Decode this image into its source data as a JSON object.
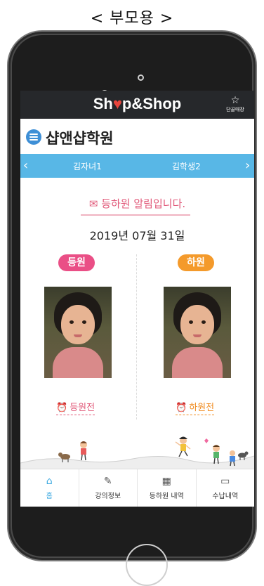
{
  "caption": "< 부모용 >",
  "header": {
    "logo_pre": "Sh",
    "logo_pin": "♥",
    "logo_post": "p&Shop",
    "store_icon": "star-icon",
    "store_label": "단골매장"
  },
  "academy": {
    "name": "샵앤샵학원"
  },
  "children": {
    "items": [
      "김자녀1",
      "김학생2"
    ]
  },
  "notice": {
    "icon": "✉",
    "text": "등하원 알림입니다."
  },
  "date": "2019년 07월 31일",
  "checkin": {
    "badge": "등원",
    "status": "등원전",
    "status_icon": "⏰"
  },
  "checkout": {
    "badge": "하원",
    "status": "하원전",
    "status_icon": "⏰"
  },
  "nav": [
    {
      "icon": "home-icon",
      "label": "홈"
    },
    {
      "icon": "edit-icon",
      "label": "강의정보"
    },
    {
      "icon": "calendar-icon",
      "label": "등하원 내역"
    },
    {
      "icon": "card-icon",
      "label": "수납내역"
    }
  ],
  "colors": {
    "topbar": "#26282b",
    "childbar": "#58b7e6",
    "checkin": "#ea4f86",
    "checkout": "#f49a2b",
    "nav_active": "#3aa8e0"
  }
}
